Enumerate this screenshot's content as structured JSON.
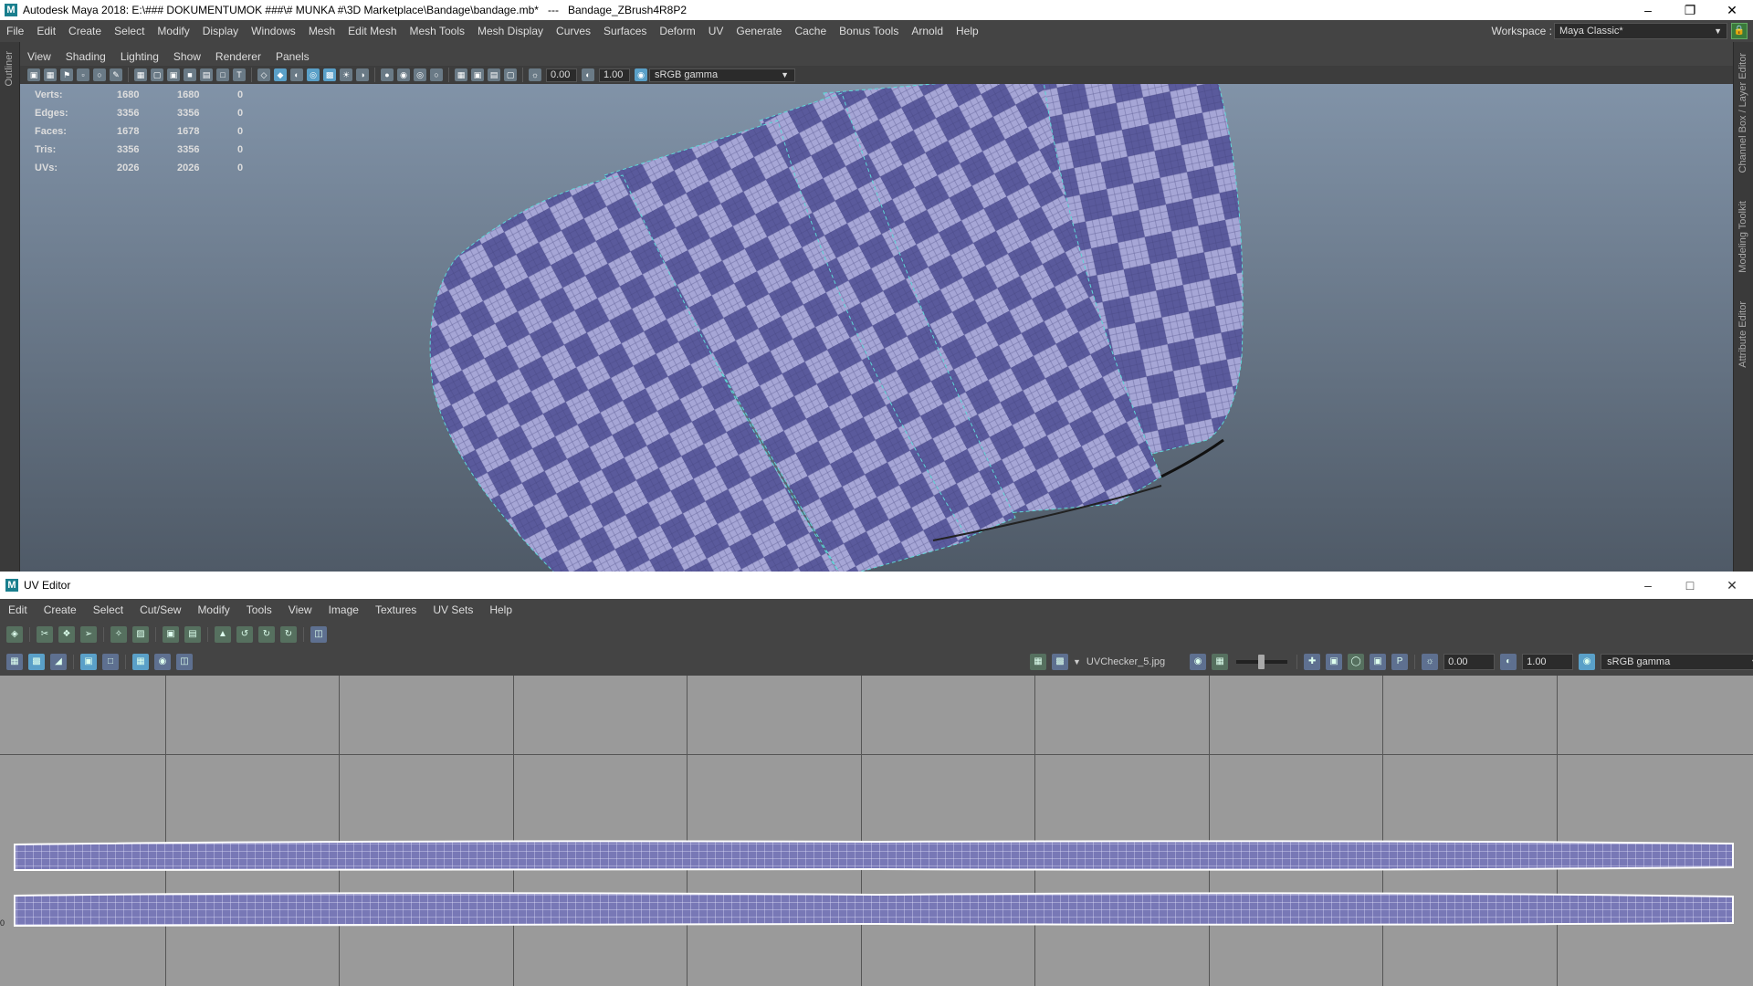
{
  "titlebar": {
    "app_title": "Autodesk Maya 2018: E:\\### DOKUMENTUMOK ###\\# MUNKA #\\3D Marketplace\\Bandage\\bandage.mb*   ---   Bandage_ZBrush4R8P2",
    "logo": "M"
  },
  "main_menu": [
    "File",
    "Edit",
    "Create",
    "Select",
    "Modify",
    "Display",
    "Windows",
    "Mesh",
    "Edit Mesh",
    "Mesh Tools",
    "Mesh Display",
    "Curves",
    "Surfaces",
    "Deform",
    "UV",
    "Generate",
    "Cache",
    "Bonus Tools",
    "Arnold",
    "Help"
  ],
  "workspace": {
    "label": "Workspace :",
    "value": "Maya Classic*"
  },
  "side_tabs": {
    "left": "Outliner",
    "right": [
      "Channel Box / Layer Editor",
      "Modeling Toolkit",
      "Attribute Editor"
    ]
  },
  "viewport": {
    "menu": [
      "View",
      "Shading",
      "Lighting",
      "Show",
      "Renderer",
      "Panels"
    ],
    "exposure": "0.00",
    "gamma": "1.00",
    "color_space": "sRGB gamma",
    "stats": [
      {
        "label": "Verts:",
        "v1": "1680",
        "v2": "1680",
        "v3": "0"
      },
      {
        "label": "Edges:",
        "v1": "3356",
        "v2": "3356",
        "v3": "0"
      },
      {
        "label": "Faces:",
        "v1": "1678",
        "v2": "1678",
        "v3": "0"
      },
      {
        "label": "Tris:",
        "v1": "3356",
        "v2": "3356",
        "v3": "0"
      },
      {
        "label": "UVs:",
        "v1": "2026",
        "v2": "2026",
        "v3": "0"
      }
    ]
  },
  "uv_editor": {
    "title": "UV Editor",
    "menu": [
      "Edit",
      "Create",
      "Select",
      "Cut/Sew",
      "Modify",
      "Tools",
      "View",
      "Image",
      "Textures",
      "UV Sets",
      "Help"
    ],
    "texture_name": "UVChecker_5.jpg",
    "exposure": "0.00",
    "gamma": "1.00",
    "color_space": "sRGB gamma",
    "axis_label": "0"
  },
  "colors": {
    "checker_dark": "#5a5a9c",
    "checker_light": "#a6a6d6",
    "seam": "#5ed8d8",
    "uv_canvas": "#9a9a9a",
    "viewport_top": "#8193a8"
  },
  "icons": [
    "minimize-icon",
    "maximize-icon",
    "close-icon",
    "lock-icon",
    "camera-icon",
    "grid-icon",
    "checker-icon",
    "exposure-icon",
    "gamma-icon",
    "color-management-icon"
  ]
}
